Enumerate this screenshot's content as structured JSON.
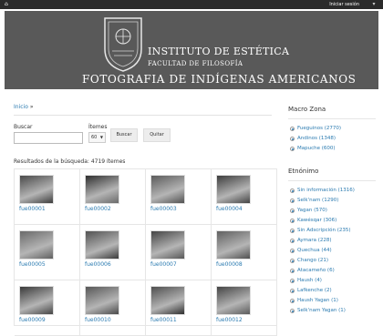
{
  "topbar": {
    "login_label": "Iniciar sesión"
  },
  "header": {
    "institute": "INSTITUTO DE ESTÉTICA",
    "faculty": "FACULTAD DE FILOSOFÍA",
    "site_title": "FOTOGRAFIA DE INDÍGENAS AMERICANOS"
  },
  "breadcrumb": {
    "home": "Inicio",
    "sep": "»"
  },
  "search": {
    "label": "Buscar",
    "value": "",
    "items_label": "Ítemes",
    "items_selected": "60",
    "search_button": "Buscar",
    "clear_button": "Quitar"
  },
  "results": {
    "summary": "Resultados de la búsqueda: 4719 ítemes"
  },
  "items": [
    {
      "id": "fue00001"
    },
    {
      "id": "fue00002"
    },
    {
      "id": "fue00003"
    },
    {
      "id": "fue00004"
    },
    {
      "id": "fue00005"
    },
    {
      "id": "fue00006"
    },
    {
      "id": "fue00007"
    },
    {
      "id": "fue00008"
    },
    {
      "id": "fue00009"
    },
    {
      "id": "fue00010"
    },
    {
      "id": "fue00011"
    },
    {
      "id": "fue00012"
    }
  ],
  "sidebar": {
    "macro_zona": {
      "title": "Macro Zona",
      "items": [
        "Fueguinos (2770)",
        "Andinos (1348)",
        "Mapuche (600)"
      ]
    },
    "etnonimo": {
      "title": "Etnónimo",
      "items": [
        "Sin información (1316)",
        "Selk'nam (1290)",
        "Yagan (570)",
        "Kawésqar (306)",
        "Sin Adscripción (235)",
        "Aymara (228)",
        "Quechua (44)",
        "Chango (21)",
        "Atacameño (6)",
        "Haush (4)",
        "Lafkenche (2)",
        "Haush Yagan (1)",
        "Selk'nam Yagan (1)"
      ]
    }
  }
}
